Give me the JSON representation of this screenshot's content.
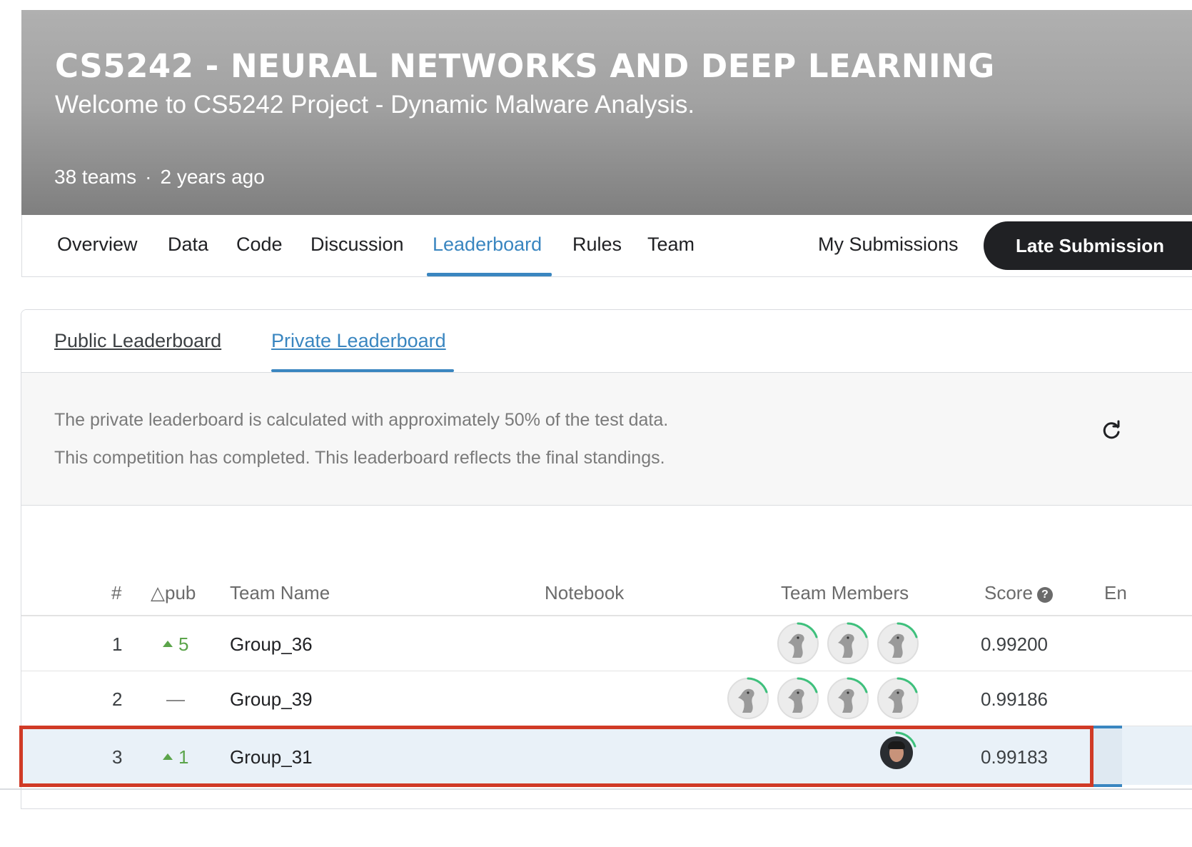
{
  "competition": {
    "title": "CS5242 - NEURAL NETWORKS AND DEEP LEARNING",
    "subtitle": "Welcome to CS5242 Project - Dynamic Malware Analysis.",
    "teams": "38 teams",
    "separator": "·",
    "age": "2 years ago"
  },
  "nav": {
    "tabs": [
      "Overview",
      "Data",
      "Code",
      "Discussion",
      "Leaderboard",
      "Rules",
      "Team"
    ],
    "active_tab": "Leaderboard",
    "my_submissions": "My Submissions",
    "late_submission": "Late Submission"
  },
  "leaderboard": {
    "tabs": {
      "public": "Public Leaderboard",
      "private": "Private Leaderboard"
    },
    "active_tab": "Private Leaderboard",
    "info_line_1": "The private leaderboard is calculated with approximately 50% of the test data.",
    "info_line_2": "This competition has completed. This leaderboard reflects the final standings.",
    "columns": {
      "rank": "#",
      "delta": "△pub",
      "team_name": "Team Name",
      "notebook": "Notebook",
      "team_members": "Team Members",
      "score": "Score",
      "entries": "En"
    },
    "rows": [
      {
        "rank": "1",
        "delta": "5",
        "delta_dir": "up",
        "team": "Group_36",
        "members": 3,
        "score": "0.99200"
      },
      {
        "rank": "2",
        "delta": "—",
        "delta_dir": "none",
        "team": "Group_39",
        "members": 4,
        "score": "0.99186"
      },
      {
        "rank": "3",
        "delta": "1",
        "delta_dir": "up",
        "team": "Group_31",
        "members": 1,
        "score": "0.99183",
        "highlighted": true
      }
    ]
  },
  "colors": {
    "accent": "#3a86c0",
    "positive": "#5ba44a",
    "highlight_border": "#d03a26",
    "button_dark": "#202124"
  }
}
